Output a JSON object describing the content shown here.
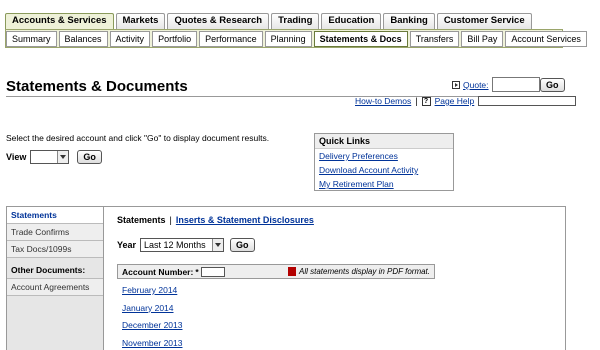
{
  "top_tabs": [
    "Accounts & Services",
    "Markets",
    "Quotes & Research",
    "Trading",
    "Education",
    "Banking",
    "Customer Service"
  ],
  "sub_tabs": [
    "Summary",
    "Balances",
    "Activity",
    "Portfolio",
    "Performance",
    "Planning",
    "Statements & Docs",
    "Transfers",
    "Bill Pay",
    "Account Services"
  ],
  "page_title": "Statements & Documents",
  "quote": {
    "label": "Quote:",
    "go": "Go"
  },
  "help": {
    "how_to": "How-to Demos",
    "sep": "|",
    "icon": "?",
    "page_help": "Page Help"
  },
  "instructions": "Select the desired account and click \"Go\" to display document results.",
  "view": {
    "label": "View",
    "value": "",
    "go": "Go"
  },
  "quick_links": {
    "title": "Quick Links",
    "items": [
      "Delivery Preferences",
      "Download Account Activity",
      "My Retirement Plan"
    ]
  },
  "sidebar": {
    "items": [
      "Statements",
      "Trade Confirms",
      "Tax Docs/1099s"
    ],
    "other_heading": "Other Documents:",
    "other_items": [
      "Account Agreements"
    ]
  },
  "content": {
    "tab_current": "Statements",
    "tab_sep": "|",
    "tab_other": "Inserts & Statement Disclosures",
    "year_label": "Year",
    "year_value": "Last 12 Months",
    "go": "Go",
    "account_label": "Account Number:",
    "account_marker": "*",
    "pdf_note": "All statements display in PDF format.",
    "statements": [
      "February 2014",
      "January 2014",
      "December 2013",
      "November 2013"
    ]
  }
}
